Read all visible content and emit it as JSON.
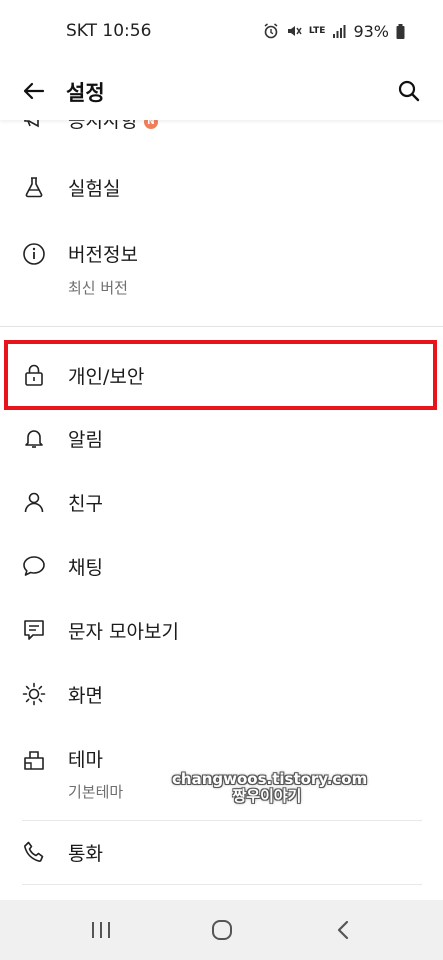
{
  "status_bar": {
    "carrier_time": "SKT 10:56",
    "battery": "93%",
    "network": "LTE"
  },
  "app_bar": {
    "title": "설정",
    "back_icon": "arrow-left-icon",
    "search_icon": "search-icon"
  },
  "list": {
    "partial_item": {
      "label": "공지사항",
      "badge": "N"
    },
    "labs": {
      "label": "실험실"
    },
    "version": {
      "label": "버전정보",
      "sub": "최신 버전"
    },
    "privacy": {
      "label": "개인/보안"
    },
    "notifications": {
      "label": "알림"
    },
    "friends": {
      "label": "친구"
    },
    "chats": {
      "label": "채팅"
    },
    "sms": {
      "label": "문자 모아보기"
    },
    "display": {
      "label": "화면"
    },
    "theme": {
      "label": "테마",
      "sub": "기본테마"
    },
    "calls": {
      "label": "통화"
    }
  },
  "watermark": {
    "line1": "changwoos.tistory.com",
    "line2": "짱우이야기"
  },
  "highlight": {
    "color": "#e8141c"
  }
}
